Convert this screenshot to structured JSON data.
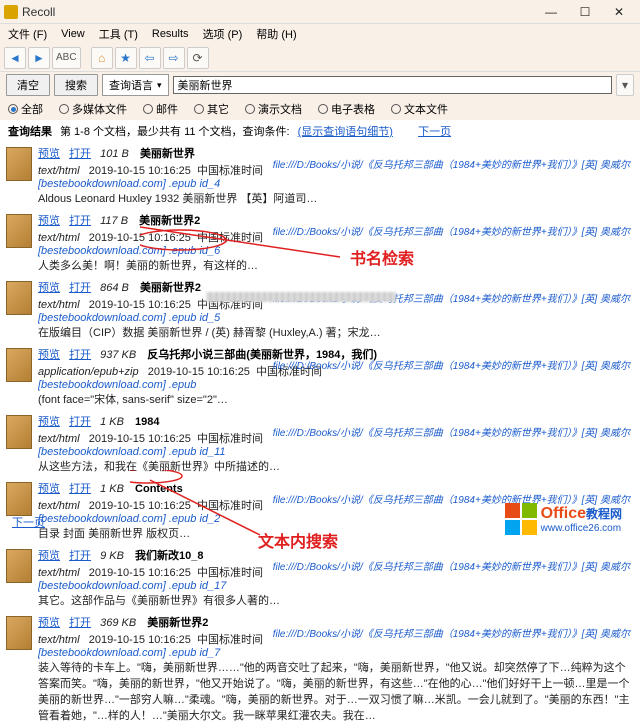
{
  "window": {
    "title": "Recoll",
    "min": "—",
    "max": "☐",
    "close": "✕"
  },
  "menu": {
    "file": "文件 (F)",
    "view": "View",
    "tools": "工具 (T)",
    "results": "Results",
    "options": "选项 (P)",
    "help": "帮助 (H)"
  },
  "search": {
    "clear": "清空",
    "go": "搜索",
    "lang_label": "查询语言",
    "query": "美丽新世界"
  },
  "filters": {
    "all": "全部",
    "media": "多媒体文件",
    "mail": "邮件",
    "other": "其它",
    "slides": "演示文档",
    "sheet": "电子表格",
    "text": "文本文件"
  },
  "status": {
    "label": "查询结果",
    "range": "第 1-8 个文档，最少共有 11 个文档，查询条件: ",
    "detail": "(显示查询语句细节)",
    "nextpage": "下一页"
  },
  "links": {
    "preview": "预览",
    "open": "打开"
  },
  "annotations": {
    "title_search": "书名检索",
    "body_search": "文本内搜索"
  },
  "footer": {
    "nextpage": "下一页"
  },
  "logo": {
    "t1": "Office",
    "t2": "教程网",
    "url": "www.office26.com"
  },
  "results": [
    {
      "size": "101 B",
      "title": "美丽新世界",
      "mime": "text/html",
      "date": "2019-10-15 10:16:25",
      "abs": "中国标准时间",
      "src": "[bestebookdownload.com] .epub  id_4",
      "snippet": "Aldous Leonard Huxley 1932  美丽新世界  【英】阿道司…",
      "path": "file:///D:/Books/小说/《反乌托邦三部曲（1984+美妙的新世界+我们）》[英] 奥威尔"
    },
    {
      "size": "117 B",
      "title": "美丽新世界2",
      "mime": "text/html",
      "date": "2019-10-15 10:16:25",
      "abs": "中国标准时间",
      "src": "[bestebookdownload.com] .epub  id_6",
      "snippet": "人类多么美！啊！美丽的新世界，有这样的…",
      "path": "file:///D:/Books/小说/《反乌托邦三部曲（1984+美妙的新世界+我们）》[英] 奥威尔"
    },
    {
      "size": "864 B",
      "title": "美丽新世界2",
      "mime": "text/html",
      "date": "2019-10-15 10:16:25",
      "abs": "中国标准时间",
      "src": "[bestebookdownload.com] .epub  id_5",
      "snippet": "在版编目（CIP）数据 美丽新世界 / (英) 赫胥黎 (Huxley,A.) 著；宋龙…",
      "path": "file:///D:/Books/小说/《反乌托邦三部曲（1984+美妙的新世界+我们）》[英] 奥威尔"
    },
    {
      "size": "937 KB",
      "title": "反乌托邦小说三部曲(美丽新世界，1984，我们)",
      "mime": "application/epub+zip",
      "date": "2019-10-15 10:16:25",
      "abs": "中国标准时间",
      "src": "[bestebookdownload.com] .epub",
      "snippet": "(font face=\"宋体, sans-serif\" size=\"2\"…",
      "path": "file:///D:/Books/小说/《反乌托邦三部曲（1984+美妙的新世界+我们）》[英] 奥威尔"
    },
    {
      "size": "1 KB",
      "title": "1984",
      "mime": "text/html",
      "date": "2019-10-15 10:16:25",
      "abs": "中国标准时间",
      "src": "[bestebookdownload.com] .epub  id_11",
      "snippet": "从这些方法，和我在《美丽新世界》中所描述的…",
      "path": "file:///D:/Books/小说/《反乌托邦三部曲（1984+美妙的新世界+我们）》[英] 奥威尔"
    },
    {
      "size": "1 KB",
      "title": "Contents",
      "mime": "text/html",
      "date": "2019-10-15 10:16:25",
      "abs": "中国标准时间",
      "src": "[bestebookdownload.com] .epub  id_2",
      "snippet": "目录 封面 美丽新世界 版权页…",
      "path": "file:///D:/Books/小说/《反乌托邦三部曲（1984+美妙的新世界+我们）》[英] 奥威尔"
    },
    {
      "size": "9 KB",
      "title": "我们新改10_8",
      "mime": "text/html",
      "date": "2019-10-15 10:16:25",
      "abs": "中国标准时间",
      "src": "[bestebookdownload.com] .epub  id_17",
      "snippet": "其它。这部作品与《美丽新世界》有很多人著的…",
      "path": "file:///D:/Books/小说/《反乌托邦三部曲（1984+美妙的新世界+我们）》[英] 奥威尔"
    },
    {
      "size": "369 KB",
      "title": "美丽新世界2",
      "mime": "text/html",
      "date": "2019-10-15 10:16:25",
      "abs": "中国标准时间",
      "src": "[bestebookdownload.com] .epub  id_7",
      "snippet": "装入等待的卡车上。\"嗨，美丽新世界……\"他的两音交吐了起来，\"嗨，美丽新世界，\"他又说。却突然停了下…纯粹为这个答案而笑。\"嗨，美丽的新世界，\"他又开始说了。\"嗨，美丽的新世界，有这些…\"在他的心…\"他们好好干上一顿…里是一个美丽的新世界…\"一部穷人嘛…\"柔魂。\"嗨，美丽的新世界。对于…一双习惯了嘛…米凯。一会儿就到了。\"美丽的东西！\"主管看着她，\"…样的人！…\"美丽大尔文。我一眯苹果红灌农夫。我在…",
      "path": "file:///D:/Books/小说/《反乌托邦三部曲（1984+美妙的新世界+我们）》[英] 奥威尔"
    }
  ]
}
